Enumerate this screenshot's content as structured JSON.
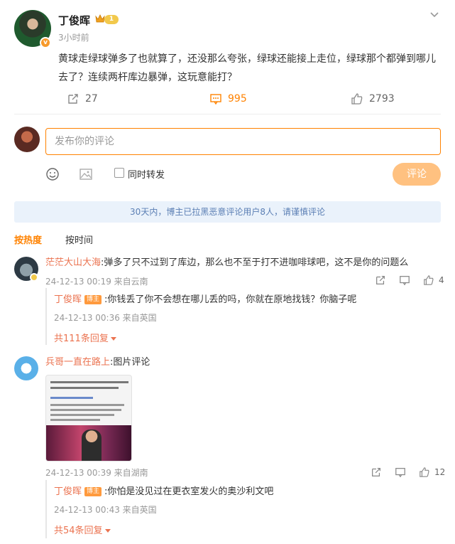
{
  "post": {
    "author": "丁俊晖",
    "level": "1",
    "time": "3小时前",
    "text": "黄球走绿球弹多了也就算了，还没那么夸张，绿球还能接上走位，绿球那个都弹到哪儿去了？连续两杆库边暴弹，这玩意能打？",
    "reposts": "27",
    "comments": "995",
    "likes": "2793"
  },
  "composer": {
    "placeholder": "发布你的评论",
    "also_repost": "同时转发",
    "submit": "评论"
  },
  "notice": "30天内，博主已拉黑恶意评论用户8人，请谨慎评论",
  "sort": {
    "hot": "按热度",
    "time": "按时间"
  },
  "comments": [
    {
      "user": "茫茫大山大海",
      "text": ":弹多了只不过到了库边，那么也不至于打不进咖啡球吧，这不是你的问题么",
      "meta": "24-12-13 00:19 来自云南",
      "likes": "4",
      "reply": {
        "user": "丁俊晖",
        "tag": "博主",
        "text": ":你钱丢了你不会想在哪儿丢的吗，你就在原地找钱？你脑子呢",
        "meta": "24-12-13 00:36 来自英国"
      },
      "more": "共111条回复"
    },
    {
      "user": "兵哥一直在路上",
      "text": ":图片评论",
      "meta": "24-12-13 00:39 来自湖南",
      "likes": "12",
      "reply": {
        "user": "丁俊晖",
        "tag": "博主",
        "text": ":你怕是没见过在更衣室发火的奥沙利文吧",
        "meta": "24-12-13 00:43 来自英国"
      },
      "more": "共54条回复"
    }
  ]
}
